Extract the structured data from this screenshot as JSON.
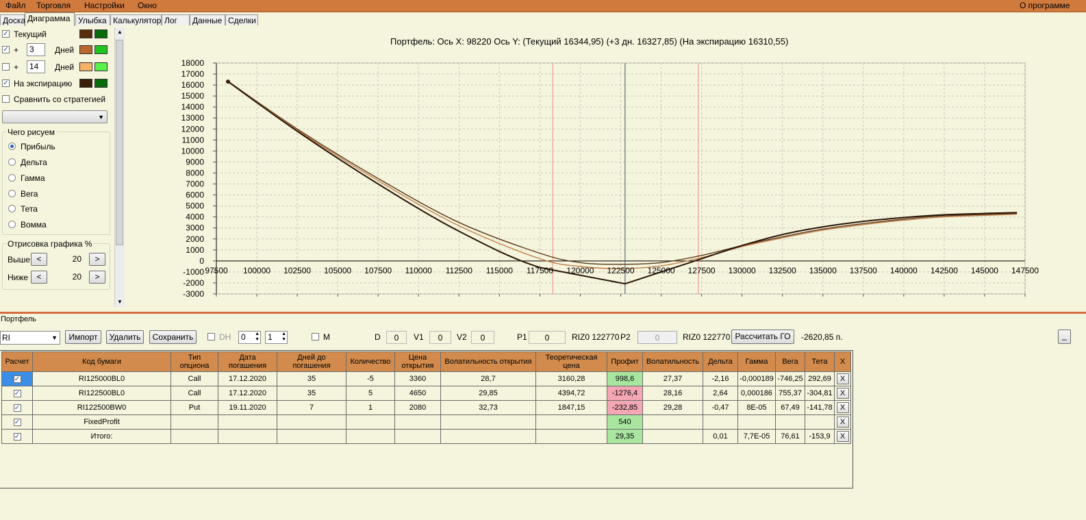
{
  "menu": {
    "items": [
      "Файл",
      "Торговля",
      "Настройки",
      "Окно"
    ],
    "about": "О программе"
  },
  "tabs": [
    "Доска",
    "Диаграмма",
    "Улыбка",
    "Калькулятор",
    "Лог",
    "Данные",
    "Сделки"
  ],
  "active_tab": "Диаграмма",
  "left": {
    "current_label": "Текущий",
    "plus": "+",
    "days_label": "Дней",
    "days1": "3",
    "days2": "14",
    "expiration_label": "На экспирацию",
    "compare_label": "Сравнить со стратегией",
    "compare_value": "",
    "draw_group": "Чего рисуем",
    "radios": [
      "Прибыль",
      "Дельта",
      "Гамма",
      "Вега",
      "Тета",
      "Вомма"
    ],
    "selected_radio": "Прибыль",
    "draw_pct_group": "Отрисовка графика %",
    "above_label": "Выше",
    "below_label": "Ниже",
    "above_value": "20",
    "below_value": "20",
    "dec": "<",
    "inc": ">",
    "colors": {
      "current": [
        "#5a2d0c",
        "#0a6b0a"
      ],
      "plus3": [
        "#b8672f",
        "#22c422"
      ],
      "plus14": [
        "#f7b26a",
        "#5cf04a"
      ],
      "expiration": [
        "#3a1e08",
        "#0a6b0a"
      ]
    }
  },
  "chart_title": "Портфель: Ось X: 98220 Ось Y:  (Текущий 16344,95)  (+3 дн. 16327,85)  (На экспирацию 16310,55)",
  "chart_data": {
    "type": "line",
    "xlim": [
      97500,
      147500
    ],
    "ylim": [
      -3000,
      18000
    ],
    "x_ticks": [
      97500,
      100000,
      102500,
      105000,
      107500,
      110000,
      112500,
      115000,
      117500,
      120000,
      122500,
      125000,
      127500,
      130000,
      132500,
      135000,
      137500,
      140000,
      142500,
      145000,
      147500
    ],
    "y_ticks": [
      -3000,
      -2000,
      -1000,
      0,
      1000,
      2000,
      3000,
      4000,
      5000,
      6000,
      7000,
      8000,
      9000,
      10000,
      11000,
      12000,
      13000,
      14000,
      15000,
      16000,
      17000,
      18000
    ],
    "grid": true,
    "vlines_red": [
      118300,
      127300
    ],
    "vline_current": 122770,
    "series": [
      {
        "color": "#5a3a1a",
        "x": [
          98220,
          102500,
          107500,
          112500,
          117500,
          120000,
          122500,
          125000,
          127500,
          130000,
          132500,
          135000,
          137500,
          140000,
          142500,
          147000
        ],
        "y": [
          16345,
          12000,
          7500,
          3500,
          700,
          -150,
          -300,
          -150,
          500,
          1400,
          2200,
          2900,
          3400,
          3800,
          4100,
          4300
        ]
      },
      {
        "color": "#c07f4a",
        "x": [
          98220,
          102500,
          107500,
          112500,
          117500,
          120000,
          122500,
          125000,
          127500,
          130000,
          132500,
          135000,
          137500,
          140000,
          142500,
          147000
        ],
        "y": [
          16328,
          11900,
          7300,
          3200,
          200,
          -500,
          -700,
          -450,
          300,
          1300,
          2100,
          2800,
          3300,
          3700,
          4000,
          4250
        ]
      },
      {
        "color": "#2a1508",
        "x": [
          98220,
          102500,
          107500,
          112500,
          117500,
          122770,
          125000,
          127500,
          130000,
          132500,
          135000,
          137500,
          140000,
          142500,
          147000
        ],
        "y": [
          16311,
          11800,
          7000,
          2700,
          -600,
          -2080,
          -1000,
          200,
          1400,
          2400,
          3100,
          3600,
          3950,
          4200,
          4400
        ]
      }
    ]
  },
  "portfolio": {
    "caption": "Портфель",
    "symbol": "RI",
    "import": "Импорт",
    "delete": "Удалить",
    "save": "Сохранить",
    "dh": "DH",
    "spin1": "0",
    "spin2": "1",
    "m": "M",
    "d_label": "D",
    "d_value": "0",
    "v1_label": "V1",
    "v1_value": "0",
    "v2_label": "V2",
    "v2_value": "0",
    "p1_label": "P1",
    "p1_value": "0",
    "riz1": "RIZ0 122770",
    "p2_label": "P2",
    "p2_value": "0",
    "riz2": "RIZ0 122770",
    "calc_go": "Рассчитать ГО",
    "go_value": "-2620,85 п.",
    "min_btn": "_"
  },
  "table": {
    "headers": [
      "Расчет",
      "Код бумаги",
      "Тип опциона",
      "Дата погашения",
      "Дней до погашения",
      "Количество",
      "Цена открытия",
      "Волатильность открытия",
      "Теоретическая цена",
      "Профит",
      "Волатильность",
      "Дельта",
      "Гамма",
      "Вега",
      "Тета",
      "X"
    ],
    "rows": [
      {
        "code": "RI125000BL0",
        "type": "Call",
        "date": "17.12.2020",
        "days": "35",
        "qty": "-5",
        "open": "3360",
        "vol_open": "28,7",
        "theo": "3160,28",
        "profit": "998,6",
        "profit_state": "pos",
        "vol": "27,37",
        "delta": "-2,16",
        "gamma": "-0,000189",
        "vega": "-746,25",
        "theta": "292,69"
      },
      {
        "code": "RI122500BL0",
        "type": "Call",
        "date": "17.12.2020",
        "days": "35",
        "qty": "5",
        "open": "4650",
        "vol_open": "29,85",
        "theo": "4394,72",
        "profit": "-1276,4",
        "profit_state": "neg",
        "vol": "28,16",
        "delta": "2,64",
        "gamma": "0,000186",
        "vega": "755,37",
        "theta": "-304,81"
      },
      {
        "code": "RI122500BW0",
        "type": "Put",
        "date": "19.11.2020",
        "days": "7",
        "qty": "1",
        "open": "2080",
        "vol_open": "32,73",
        "theo": "1847,15",
        "profit": "-232,85",
        "profit_state": "neg",
        "vol": "29,28",
        "delta": "-0,47",
        "gamma": "8E-05",
        "vega": "67,49",
        "theta": "-141,78"
      },
      {
        "code": "FixedProfit",
        "type": "",
        "date": "",
        "days": "",
        "qty": "",
        "open": "",
        "vol_open": "",
        "theo": "",
        "profit": "540",
        "profit_state": "pos",
        "vol": "",
        "delta": "",
        "gamma": "",
        "vega": "",
        "theta": ""
      },
      {
        "code": "Итого:",
        "type": "",
        "date": "",
        "days": "",
        "qty": "",
        "open": "",
        "vol_open": "",
        "theo": "",
        "profit": "29,35",
        "profit_state": "pos",
        "vol": "",
        "delta": "0,01",
        "gamma": "7,7E-05",
        "vega": "76,61",
        "theta": "-153,9"
      }
    ],
    "x_label": "X",
    "check": "✓"
  }
}
